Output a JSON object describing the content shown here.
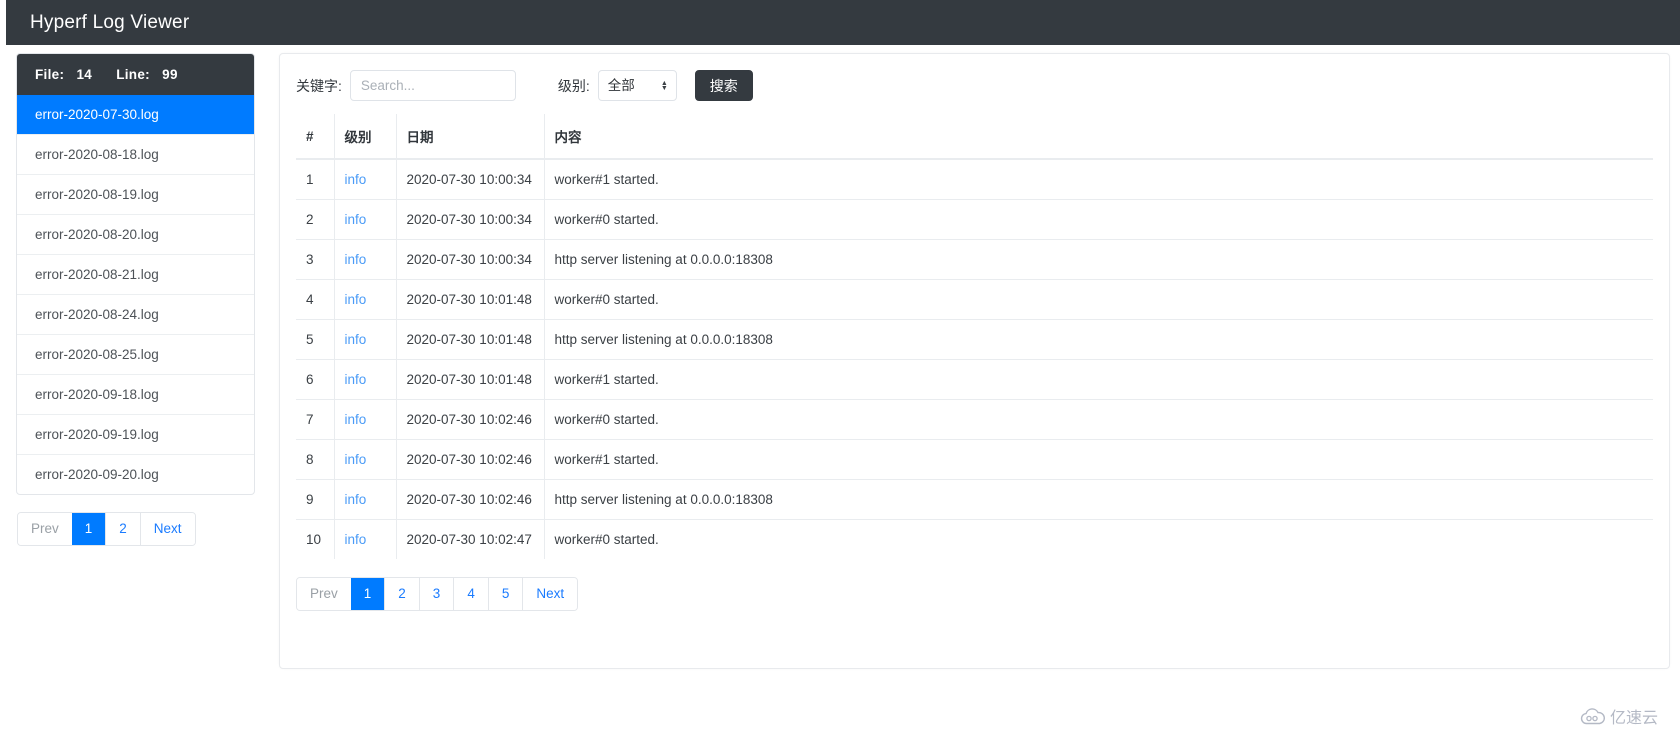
{
  "header": {
    "title": "Hyperf Log Viewer"
  },
  "sidebar": {
    "summary": {
      "file_label": "File:",
      "file_count": "14",
      "line_label": "Line:",
      "line_count": "99"
    },
    "files": [
      {
        "name": "error-2020-07-30.log",
        "active": true
      },
      {
        "name": "error-2020-08-18.log",
        "active": false
      },
      {
        "name": "error-2020-08-19.log",
        "active": false
      },
      {
        "name": "error-2020-08-20.log",
        "active": false
      },
      {
        "name": "error-2020-08-21.log",
        "active": false
      },
      {
        "name": "error-2020-08-24.log",
        "active": false
      },
      {
        "name": "error-2020-08-25.log",
        "active": false
      },
      {
        "name": "error-2020-09-18.log",
        "active": false
      },
      {
        "name": "error-2020-09-19.log",
        "active": false
      },
      {
        "name": "error-2020-09-20.log",
        "active": false
      }
    ],
    "pagination": {
      "prev": "Prev",
      "next": "Next",
      "pages": [
        "1",
        "2"
      ],
      "current": "1"
    }
  },
  "toolbar": {
    "keyword_label": "关键字:",
    "keyword_value": "",
    "keyword_placeholder": "Search...",
    "level_label": "级别:",
    "level_selected": "全部",
    "level_options": [
      "全部"
    ],
    "search_button": "搜索"
  },
  "table": {
    "columns": [
      "#",
      "级别",
      "日期",
      "内容"
    ],
    "rows": [
      {
        "index": "1",
        "level": "info",
        "date": "2020-07-30 10:00:34",
        "content": "worker#1 started."
      },
      {
        "index": "2",
        "level": "info",
        "date": "2020-07-30 10:00:34",
        "content": "worker#0 started."
      },
      {
        "index": "3",
        "level": "info",
        "date": "2020-07-30 10:00:34",
        "content": "http server listening at 0.0.0.0:18308"
      },
      {
        "index": "4",
        "level": "info",
        "date": "2020-07-30 10:01:48",
        "content": "worker#0 started."
      },
      {
        "index": "5",
        "level": "info",
        "date": "2020-07-30 10:01:48",
        "content": "http server listening at 0.0.0.0:18308"
      },
      {
        "index": "6",
        "level": "info",
        "date": "2020-07-30 10:01:48",
        "content": "worker#1 started."
      },
      {
        "index": "7",
        "level": "info",
        "date": "2020-07-30 10:02:46",
        "content": "worker#0 started."
      },
      {
        "index": "8",
        "level": "info",
        "date": "2020-07-30 10:02:46",
        "content": "worker#1 started."
      },
      {
        "index": "9",
        "level": "info",
        "date": "2020-07-30 10:02:46",
        "content": "http server listening at 0.0.0.0:18308"
      },
      {
        "index": "10",
        "level": "info",
        "date": "2020-07-30 10:02:47",
        "content": "worker#0 started."
      }
    ],
    "pagination": {
      "prev": "Prev",
      "next": "Next",
      "pages": [
        "1",
        "2",
        "3",
        "4",
        "5"
      ],
      "current": "1"
    }
  },
  "watermark": {
    "text": "亿速云",
    "icon": "cloud-icon"
  },
  "colors": {
    "navbar_bg": "#343a40",
    "accent_blue": "#007bff",
    "link_blue": "#4a9bf7",
    "border": "#e9ecef"
  }
}
